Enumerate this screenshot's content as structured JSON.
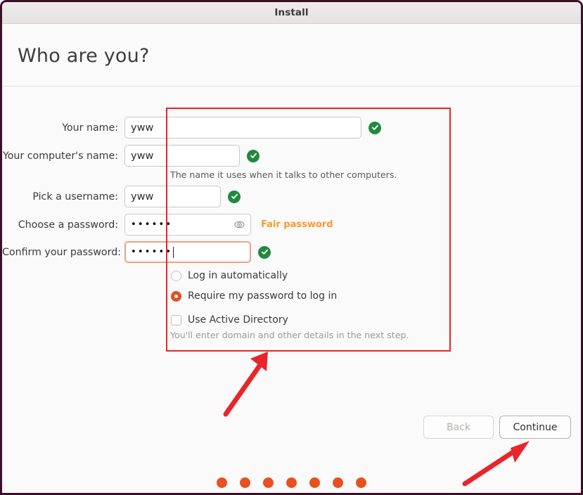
{
  "window": {
    "title": "Install",
    "border_color": "#3b1027"
  },
  "page": {
    "heading": "Who are you?"
  },
  "form": {
    "fields": [
      {
        "label": "Your name:",
        "value": "yww",
        "valid": true
      },
      {
        "label": "Your computer's name:",
        "value": "yww",
        "valid": true
      },
      {
        "label": "Pick a username:",
        "value": "yww",
        "valid": true
      }
    ],
    "computer_name_hint": "The name it uses when it talks to other computers.",
    "password": {
      "label": "Choose a password:",
      "value": "••••••",
      "strength_text": "Fair password",
      "strength_color": "#fb9a2c",
      "reveal_icon": "eye-icon"
    },
    "confirm_password": {
      "label": "Confirm your password:",
      "value": "••••••",
      "valid": true,
      "focused": true
    },
    "login_options": [
      {
        "label": "Log in automatically",
        "selected": false
      },
      {
        "label": "Require my password to log in",
        "selected": true
      }
    ],
    "active_directory": {
      "label": "Use Active Directory",
      "checked": false,
      "hint": "You'll enter domain and other details in the next step."
    }
  },
  "footer": {
    "back_label": "Back",
    "back_enabled": false,
    "continue_label": "Continue",
    "continue_enabled": true,
    "progress_dots": 7,
    "progress_dot_color": "#e8511f"
  },
  "annotations": {
    "highlight_box_color": "#e8262a",
    "arrow_color": "#e8262a",
    "arrows": 2
  }
}
